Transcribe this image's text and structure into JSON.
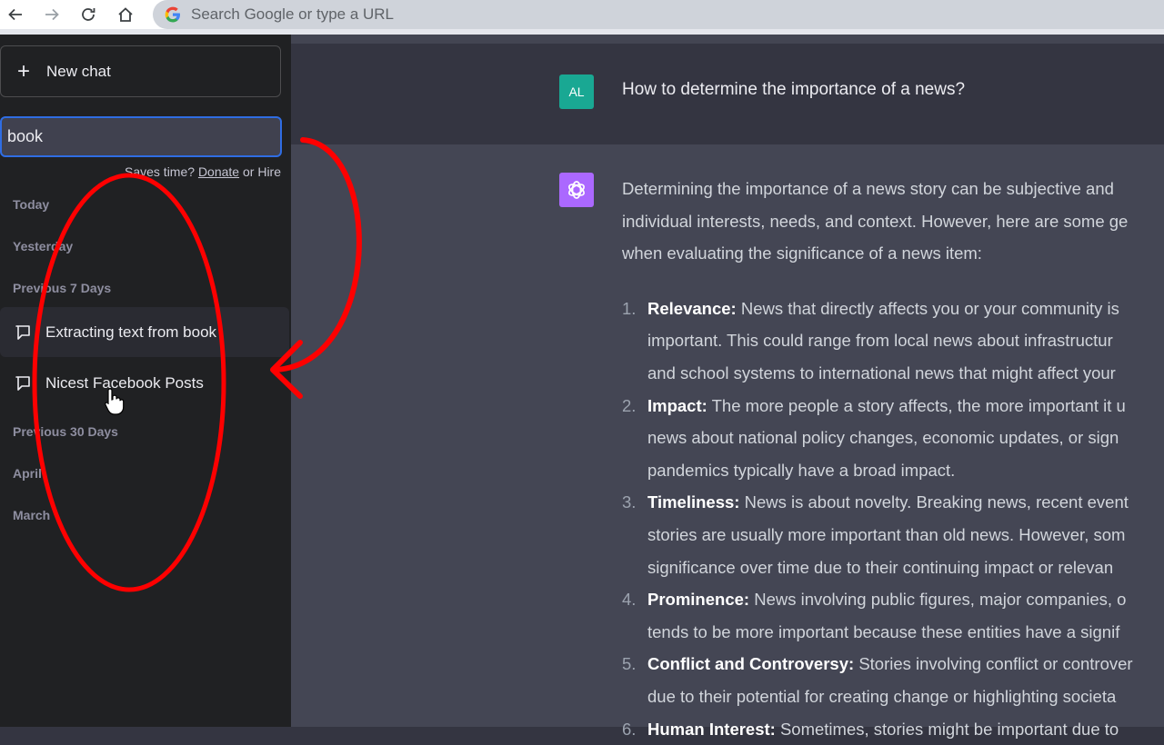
{
  "browser": {
    "back_icon": "arrow-left-icon",
    "forward_icon": "arrow-right-icon",
    "reload_icon": "reload-icon",
    "home_icon": "home-icon",
    "omnibox_placeholder": "Search Google or type a URL"
  },
  "sidebar": {
    "new_chat_label": "New chat",
    "search_value": "book",
    "promo": {
      "prefix": "Saves time?",
      "donate": "Donate",
      "middle": "or",
      "hire": "Hire"
    },
    "groups": [
      {
        "label": "Today"
      },
      {
        "label": "Yesterday"
      },
      {
        "label": "Previous 7 Days"
      },
      {
        "label": "Previous 30 Days"
      },
      {
        "label": "April"
      },
      {
        "label": "March"
      }
    ],
    "conversations": [
      {
        "title": "Extracting text from book",
        "active": true
      },
      {
        "title": "Nicest Facebook Posts",
        "active": false
      }
    ]
  },
  "chat": {
    "user": {
      "avatar_initials": "AL",
      "avatar_color": "#19a893",
      "message": "How to determine the importance of a news?"
    },
    "assistant": {
      "avatar_color": "#ab68ff",
      "intro_lines": [
        "Determining the importance of a news story can be subjective and",
        "individual interests, needs, and context. However, here are some ge",
        "when evaluating the significance of a news item:"
      ],
      "items": [
        {
          "num": "1.",
          "title": "Relevance:",
          "lines": [
            "News that directly affects you or your community is",
            "important. This could range from local news about infrastructur",
            "and school systems to international news that might affect your"
          ]
        },
        {
          "num": "2.",
          "title": "Impact:",
          "lines": [
            "The more people a story affects, the more important it u",
            "news about national policy changes, economic updates, or sign",
            "pandemics typically have a broad impact."
          ]
        },
        {
          "num": "3.",
          "title": "Timeliness:",
          "lines": [
            "News is about novelty. Breaking news, recent event",
            "stories are usually more important than old news. However, som",
            "significance over time due to their continuing impact or relevan"
          ]
        },
        {
          "num": "4.",
          "title": "Prominence:",
          "lines": [
            "News involving public figures, major companies, o",
            "tends to be more important because these entities have a signif"
          ]
        },
        {
          "num": "5.",
          "title": "Conflict and Controversy:",
          "lines": [
            "Stories involving conflict or controver",
            "due to their potential for creating change or highlighting societa"
          ]
        },
        {
          "num": "6.",
          "title": "Human Interest:",
          "lines": [
            "Sometimes, stories might be important due to"
          ]
        }
      ]
    }
  },
  "annotations": {
    "color": "#ff0000",
    "shapes": [
      "ellipse-around-history",
      "curved-arrow-to-results"
    ]
  }
}
